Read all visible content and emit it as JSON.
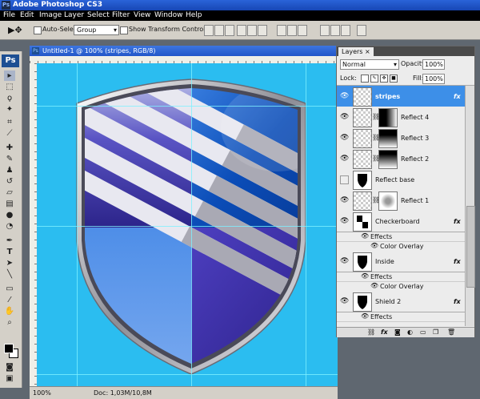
{
  "app": {
    "title": "Adobe Photoshop CS3",
    "logo": "Ps"
  },
  "menu": [
    "File",
    "Edit",
    "Image",
    "Layer",
    "Select",
    "Filter",
    "View",
    "Window",
    "Help"
  ],
  "options": {
    "auto_select_label": "Auto-Select:",
    "auto_select_value": "Group",
    "transform_label": "Show Transform Controls"
  },
  "document": {
    "tab_title": "Untitled-1 @ 100% (stripes, RGB/8)",
    "zoom": "100%",
    "doc_size": "Doc: 1,03M/10,8M",
    "background_color": "#2bbdf0"
  },
  "layers_panel": {
    "tab": "Layers",
    "blend_mode": "Normal",
    "opacity_label": "Opacity:",
    "opacity_value": "100%",
    "lock_label": "Lock:",
    "fill_label": "Fill:",
    "fill_value": "100%",
    "fx_symbol": "fx",
    "layers": [
      {
        "name": "stripes",
        "selected": true,
        "fx": true,
        "mask": false
      },
      {
        "name": "Reflect 4",
        "mask": true
      },
      {
        "name": "Reflect 3",
        "mask": true
      },
      {
        "name": "Reflect 2",
        "mask": true
      },
      {
        "name": "Reflect base",
        "hidden": true
      },
      {
        "name": "Reflect 1",
        "mask": true
      },
      {
        "name": "Checkerboard",
        "fx": true,
        "effects": [
          "Effects",
          "Color Overlay"
        ]
      },
      {
        "name": "Inside",
        "fx": true,
        "effects": [
          "Effects",
          "Color Overlay"
        ]
      },
      {
        "name": "Shield 2",
        "fx": true,
        "effects": [
          "Effects"
        ]
      }
    ]
  }
}
